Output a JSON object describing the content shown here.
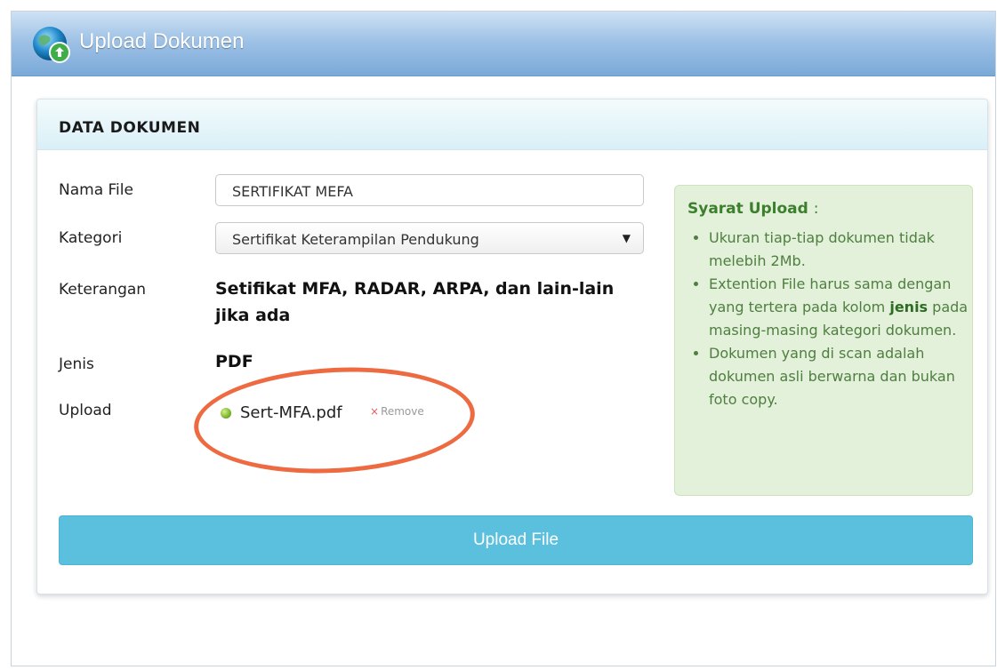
{
  "window": {
    "title": "Upload Dokumen"
  },
  "panel": {
    "title": "DATA DOKUMEN"
  },
  "form": {
    "nama_file": {
      "label": "Nama File",
      "value": "SERTIFIKAT MEFA"
    },
    "kategori": {
      "label": "Kategori",
      "selected": "Sertifikat Keterampilan Pendukung"
    },
    "keterangan": {
      "label": "Keterangan",
      "value_line1": "Setifikat MFA, RADAR, ARPA, dan lain-lain",
      "value_line2": "jika ada"
    },
    "jenis": {
      "label": "Jenis",
      "value": "PDF"
    },
    "upload": {
      "label": "Upload",
      "file_name": "Sert-MFA.pdf",
      "remove_label": "Remove"
    }
  },
  "sidebar": {
    "title": "Syarat Upload",
    "title_suffix": ":",
    "items": [
      {
        "text": "Ukuran tiap-tiap dokumen tidak melebih 2Mb."
      },
      {
        "before": "Extention File harus sama dengan yang tertera pada kolom ",
        "bold": "jenis",
        "after": " pada masing-masing kategori dokumen."
      },
      {
        "text": "Dokumen yang di scan adalah dokumen asli berwarna dan bukan foto copy."
      }
    ]
  },
  "button": {
    "upload_label": "Upload File"
  },
  "colors": {
    "titlebar": "#7aa9d8",
    "panel_header": "#d9f0f6",
    "sidebox_bg": "#e3f1da",
    "sidebox_text": "#4f7f40",
    "button_bg": "#5bc0de",
    "highlight_ring": "#ee6a41",
    "status_dot": "#6cab1c"
  },
  "icons": {
    "title_icon": "globe-upload-icon",
    "status_dot": "green-dot-icon",
    "remove": "close-icon",
    "select_arrow": "caret-down-icon"
  }
}
